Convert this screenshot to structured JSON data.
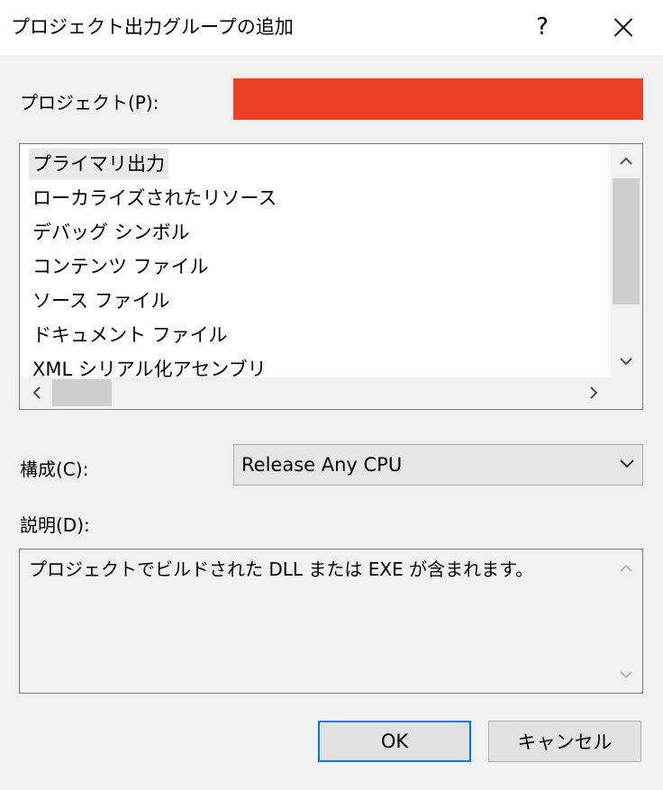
{
  "dialog": {
    "title": "プロジェクト出力グループの追加",
    "help_glyph": "?"
  },
  "project": {
    "label": "プロジェクト(P):",
    "redacted_color": "#ea4025"
  },
  "output_groups": {
    "items": [
      {
        "label": "プライマリ出力",
        "selected": true
      },
      {
        "label": "ローカライズされたリソース",
        "selected": false
      },
      {
        "label": "デバッグ シンボル",
        "selected": false
      },
      {
        "label": "コンテンツ ファイル",
        "selected": false
      },
      {
        "label": "ソース ファイル",
        "selected": false
      },
      {
        "label": "ドキュメント ファイル",
        "selected": false
      },
      {
        "label": "XML シリアル化アセンブリ",
        "selected": false
      }
    ]
  },
  "configuration": {
    "label": "構成(C):",
    "value": "Release Any CPU"
  },
  "description": {
    "label": "説明(D):",
    "text": "プロジェクトでビルドされた DLL または EXE が含まれます。"
  },
  "buttons": {
    "ok": "OK",
    "cancel": "キャンセル"
  },
  "colors": {
    "accent": "#0078d7"
  }
}
